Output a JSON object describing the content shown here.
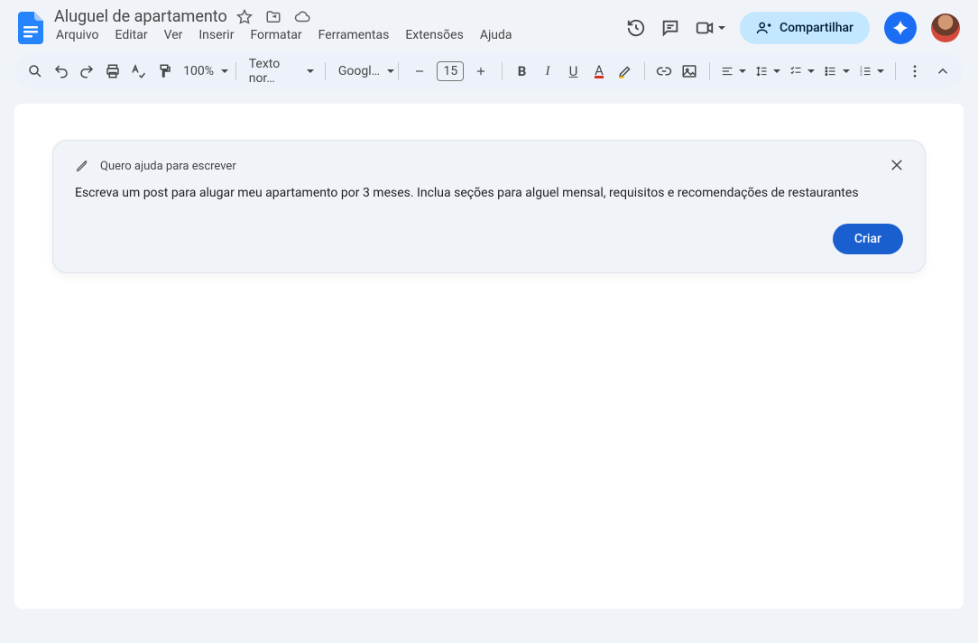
{
  "doc": {
    "title": "Aluguel de apartamento"
  },
  "menus": {
    "arquivo": "Arquivo",
    "editar": "Editar",
    "ver": "Ver",
    "inserir": "Inserir",
    "formatar": "Formatar",
    "ferramentas": "Ferramentas",
    "extensoes": "Extensões",
    "ajuda": "Ajuda"
  },
  "share": {
    "label": "Compartilhar"
  },
  "toolbar": {
    "zoom": "100%",
    "styles": "Texto nor…",
    "font": "Googl…",
    "font_size": "15"
  },
  "prompt": {
    "header": "Quero ajuda para escrever",
    "body": "Escreva um post para alugar meu apartamento por 3 meses. Inclua seções para alguel mensal, requisitos e recomendações de restaurantes",
    "action": "Criar"
  }
}
